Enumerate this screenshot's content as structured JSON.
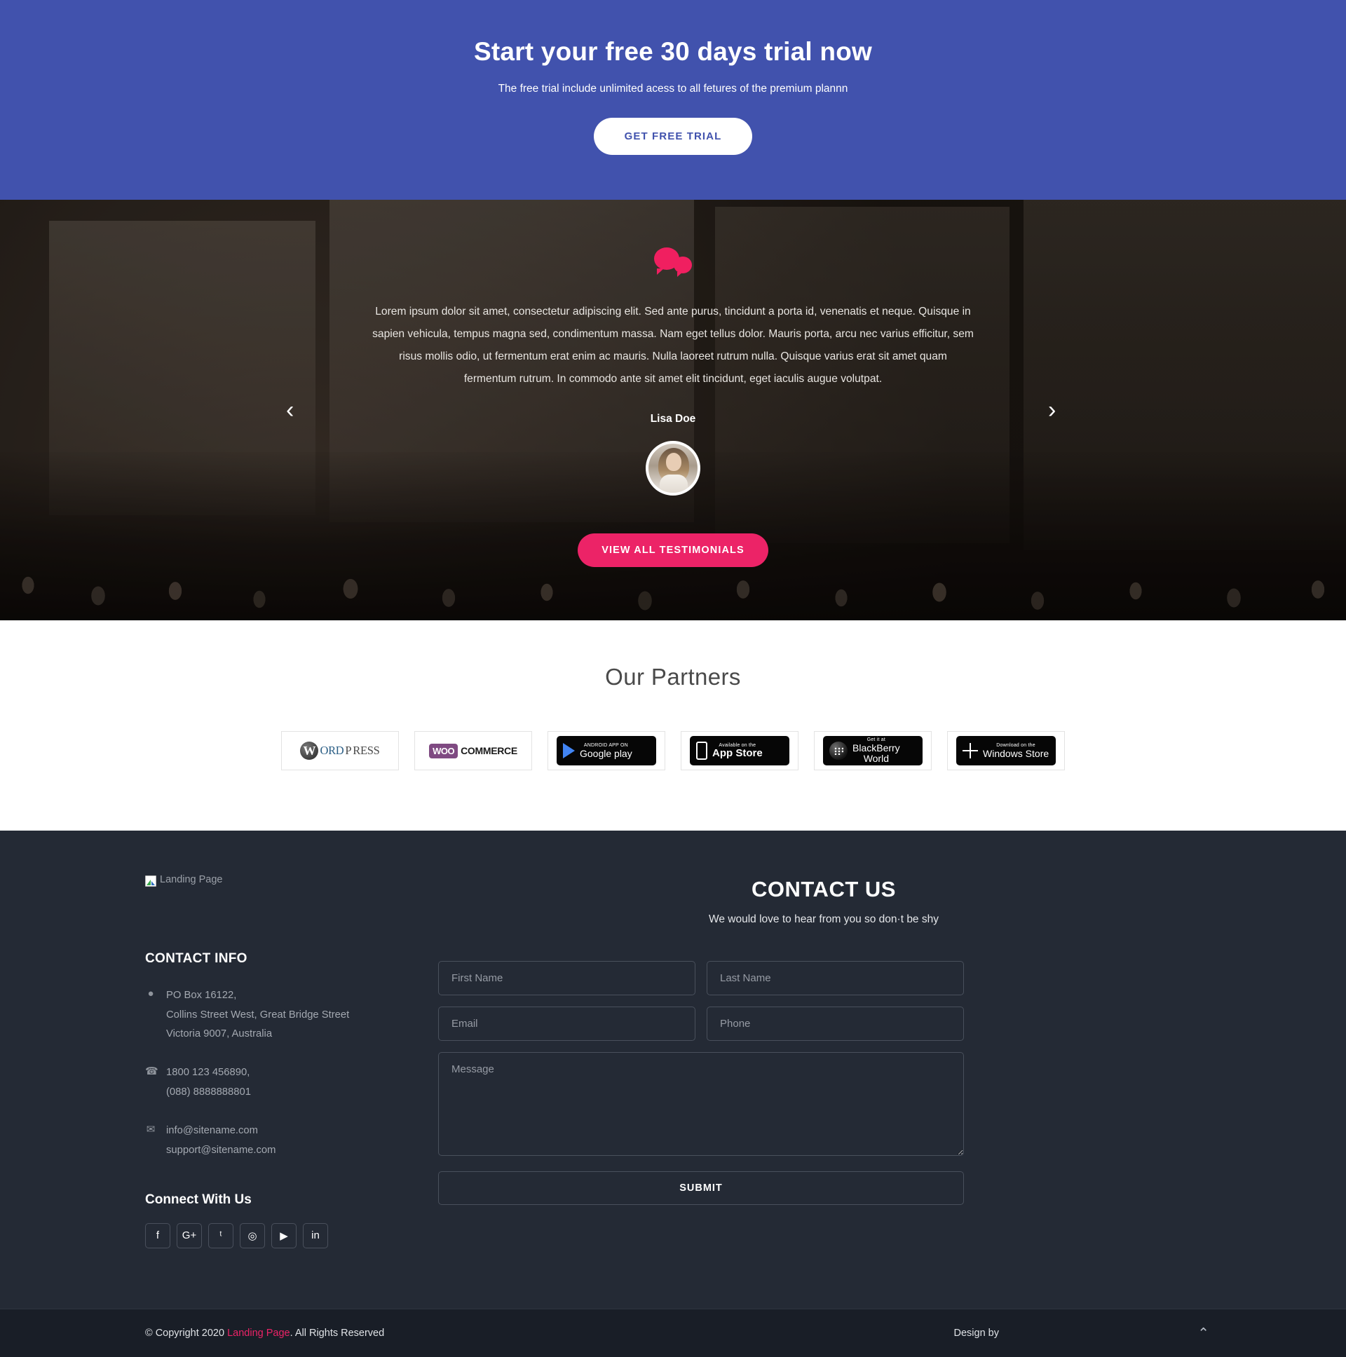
{
  "cta": {
    "title": "Start your free 30 days trial now",
    "subtitle": "The free trial include unlimited acess to all fetures of the premium plannn",
    "button_label": "GET FREE TRIAL",
    "bg_color": "#4152ad"
  },
  "testimonial": {
    "quote_icon": "chat-bubbles-icon",
    "text": "Lorem ipsum dolor sit amet, consectetur adipiscing elit. Sed ante purus, tincidunt a porta id, venenatis et neque. Quisque in sapien vehicula, tempus magna sed, condimentum massa. Nam eget tellus dolor. Mauris porta, arcu nec varius efficitur, sem risus mollis odio, ut fermentum erat enim ac mauris. Nulla laoreet rutrum nulla. Quisque varius erat sit amet quam fermentum rutrum. In commodo ante sit amet elit tincidunt, eget iaculis augue volutpat.",
    "author": "Lisa Doe",
    "prev_icon": "chevron-left-icon",
    "next_icon": "chevron-right-icon",
    "prev_glyph": "‹",
    "next_glyph": "›",
    "view_all_label": "VIEW ALL TESTIMONIALS",
    "accent_color": "#ec2367"
  },
  "partners": {
    "title": "Our Partners",
    "items": [
      {
        "name": "wordpress-logo",
        "part1": "W",
        "part2": "ORD",
        "part3": "P",
        "part4": "RESS"
      },
      {
        "name": "woocommerce-logo",
        "tag": "WOO",
        "text": "COMMERCE"
      },
      {
        "name": "google-play-badge",
        "small": "ANDROID APP ON",
        "big": "Google play"
      },
      {
        "name": "app-store-badge",
        "small": "Available on the",
        "big": "App Store"
      },
      {
        "name": "blackberry-world-badge",
        "small": "Get it at",
        "big": "BlackBerry",
        "big2": "World"
      },
      {
        "name": "windows-store-badge",
        "small": "Download on the",
        "big": "Windows Store"
      }
    ]
  },
  "footer": {
    "logo_alt": "Landing Page",
    "contact_title": "CONTACT US",
    "contact_subtitle": "We would love to hear from you so don·t be shy",
    "info_heading": "CONTACT INFO",
    "address": [
      "PO Box 16122,",
      "Collins Street West, Great Bridge Street",
      "Victoria 9007, Australia"
    ],
    "phones": [
      "1800 123 456890,",
      "(088) 8888888801"
    ],
    "emails": [
      "info@sitename.com",
      "support@sitename.com"
    ],
    "icons": {
      "address": "map-pin-icon",
      "phone": "phone-icon",
      "email": "envelope-icon"
    },
    "connect_heading": "Connect With Us",
    "social": [
      {
        "name": "facebook-icon",
        "glyph": "f"
      },
      {
        "name": "google-plus-icon",
        "glyph": "G+"
      },
      {
        "name": "twitter-icon",
        "glyph": "ᵗ"
      },
      {
        "name": "instagram-icon",
        "glyph": "◎"
      },
      {
        "name": "youtube-icon",
        "glyph": "▶"
      },
      {
        "name": "linkedin-icon",
        "glyph": "in"
      }
    ],
    "form": {
      "first_name_placeholder": "First Name",
      "last_name_placeholder": "Last Name",
      "email_placeholder": "Email",
      "phone_placeholder": "Phone",
      "message_placeholder": "Message",
      "submit_label": "SUBMIT",
      "first_name_value": "",
      "last_name_value": "",
      "email_value": "",
      "phone_value": "",
      "message_value": ""
    }
  },
  "copyright": {
    "prefix": "© Copyright 2020 ",
    "link": "Landing Page",
    "suffix": ". All Rights Reserved",
    "design_by": "Design by",
    "to_top_icon": "chevron-up-icon",
    "to_top_glyph": "⌃"
  }
}
